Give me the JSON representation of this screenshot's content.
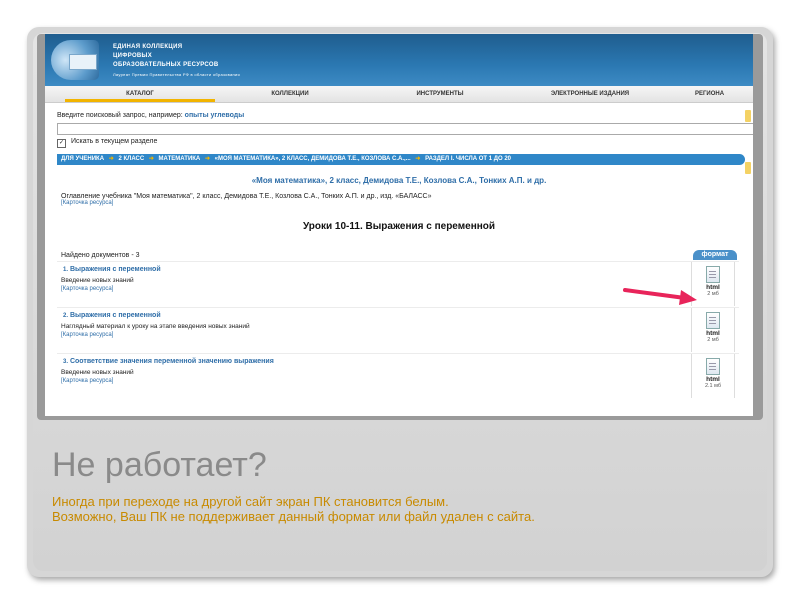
{
  "header": {
    "logo_line1": "ЕДИНАЯ КОЛЛЕКЦИЯ",
    "logo_line2": "ЦИФРОВЫХ",
    "logo_line3": "ОБРАЗОВАТЕЛЬНЫХ РЕСУРСОВ",
    "logo_sub": "Лауреат Премии Правительства РФ в области образования"
  },
  "nav": {
    "items": [
      "КАТАЛОГ",
      "КОЛЛЕКЦИИ",
      "ИНСТРУМЕНТЫ",
      "ЭЛЕКТРОННЫЕ ИЗДАНИЯ",
      "РЕГИОНА"
    ],
    "active_index": 0
  },
  "search": {
    "label": "Введите поисковый запрос, например:",
    "example": "опыты углеводы",
    "value": "",
    "checkbox_label": "Искать в текущем разделе",
    "checkbox_checked": true
  },
  "breadcrumb": {
    "items": [
      "ДЛЯ УЧЕНИКА",
      "2 КЛАСС",
      "МАТЕМАТИКА",
      "«МОЯ МАТЕМАТИКА», 2 КЛАСС, ДЕМИДОВА Т.Е., КОЗЛОВА С.А.,...",
      "РАЗДЕЛ I. ЧИСЛА ОТ 1 ДО 20"
    ]
  },
  "book": {
    "title": "«Моя математика», 2 класс, Демидова Т.Е., Козлова С.А., Тонких А.П. и др.",
    "toc": "Оглавление учебника \"Моя математика\", 2 класс, Демидова Т.Е., Козлова С.А., Тонких А.П. и др., изд. «БАЛАСС»",
    "card_link": "[Карточка ресурса]"
  },
  "lesson_title": "Уроки 10-11. Выражения с переменной",
  "found_text": "Найдено документов - 3",
  "format_header": "формат",
  "documents": [
    {
      "num": "1.",
      "title": "Выражения с переменной",
      "desc": "Введение новых знаний",
      "card": "[Карточка ресурса]",
      "format": "html",
      "size": "2 мб"
    },
    {
      "num": "2.",
      "title": "Выражения с переменной",
      "desc": "Наглядный материал к уроку на этапе введения новых знаний",
      "card": "[Карточка ресурса]",
      "format": "html",
      "size": "2 мб"
    },
    {
      "num": "3.",
      "title": "Соответствие значения переменной значению выражения",
      "desc": "Введение новых знаний",
      "card": "[Карточка ресурса]",
      "format": "html",
      "size": "2.1 мб"
    }
  ],
  "slide": {
    "heading": "Не работает?",
    "caption_line1": "Иногда при переходе на другой сайт экран ПК становится белым.",
    "caption_line2": "Возможно, Ваш ПК не поддерживает данный формат или файл удален с сайта."
  },
  "colors": {
    "brand_blue": "#2b78b2",
    "link_blue": "#2f6ea8",
    "accent_yellow": "#f2b400",
    "arrow_red": "#e8245a",
    "caption_orange": "#c88a00"
  }
}
